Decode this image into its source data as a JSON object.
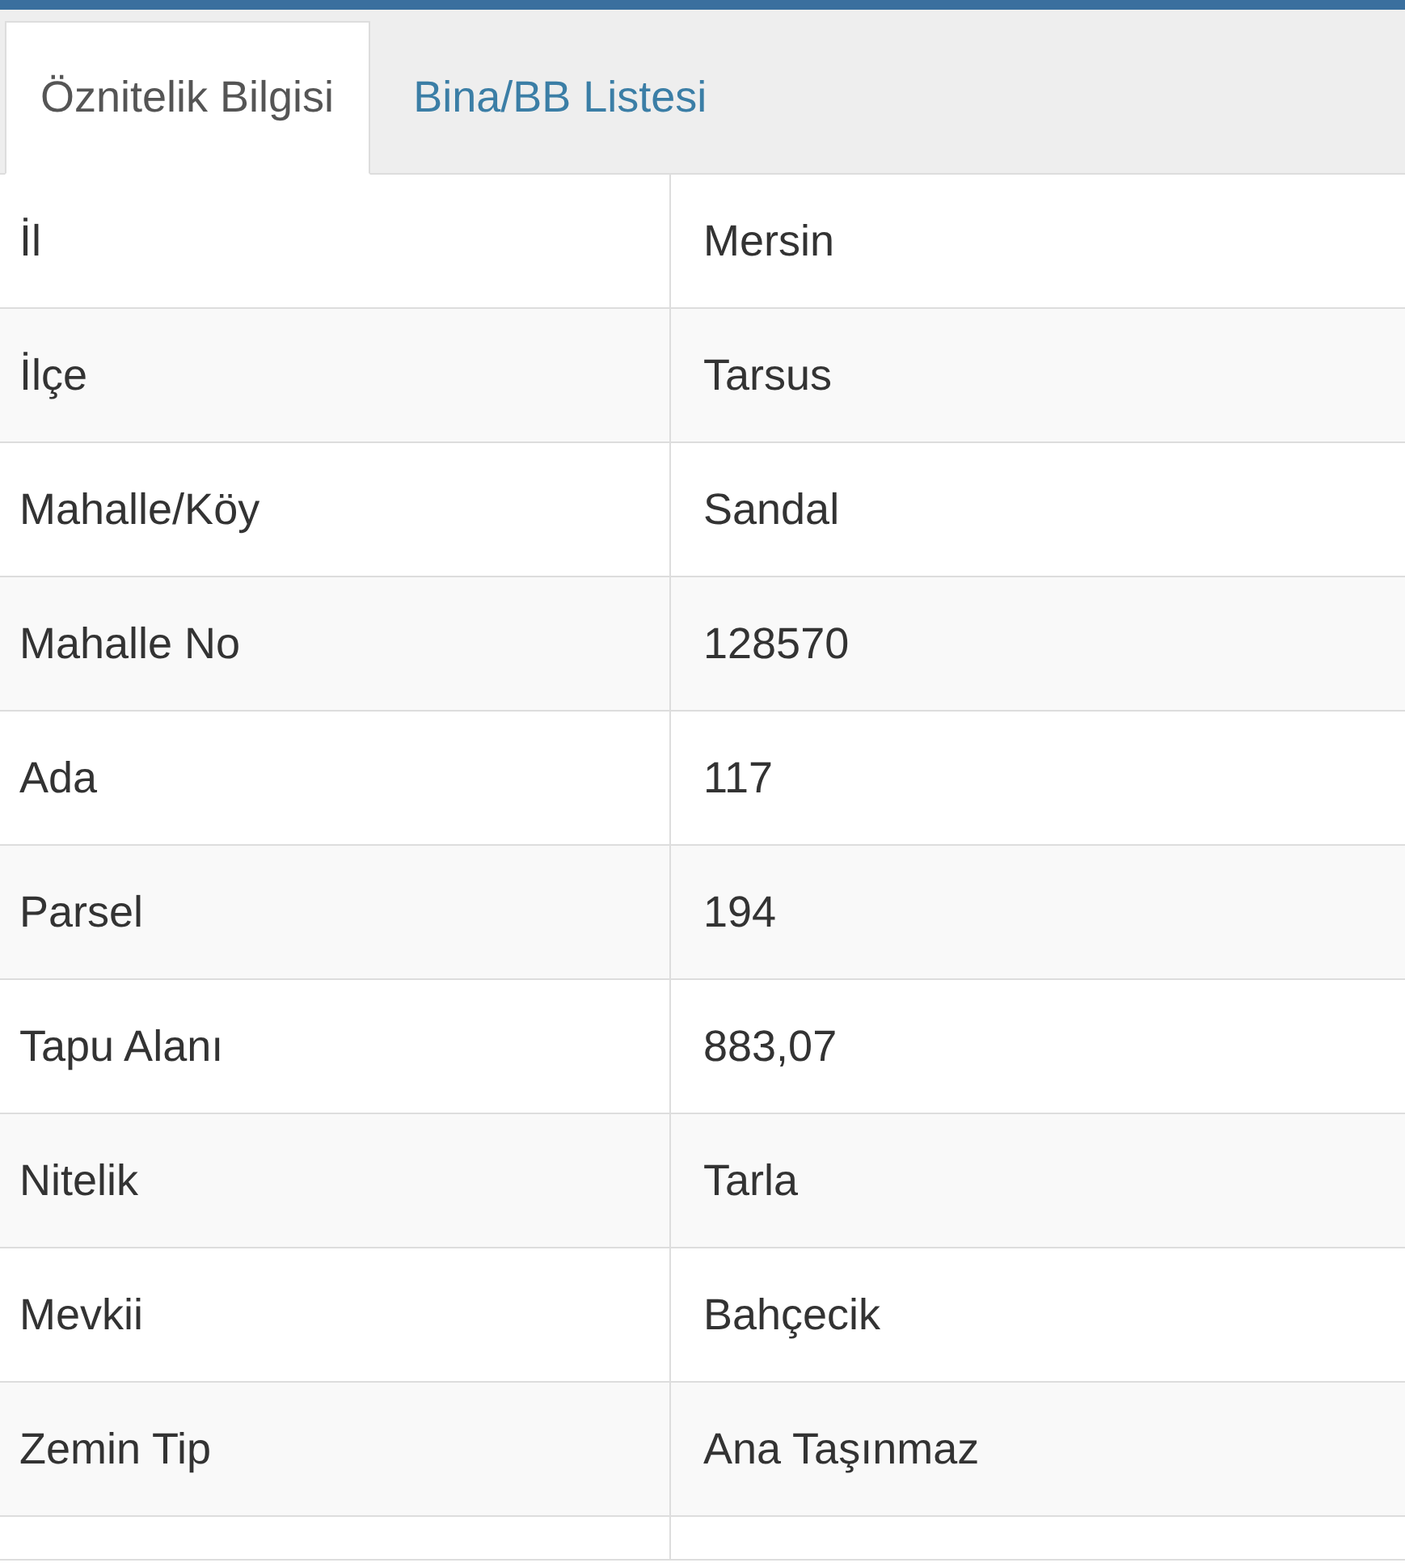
{
  "tabs": [
    {
      "label": "Öznitelik Bilgisi",
      "selected": true
    },
    {
      "label": "Bina/BB Listesi",
      "selected": false
    }
  ],
  "rows": [
    {
      "label": "İl",
      "value": "Mersin"
    },
    {
      "label": "İlçe",
      "value": "Tarsus"
    },
    {
      "label": "Mahalle/Köy",
      "value": "Sandal"
    },
    {
      "label": "Mahalle No",
      "value": "128570"
    },
    {
      "label": "Ada",
      "value": "117"
    },
    {
      "label": "Parsel",
      "value": "194"
    },
    {
      "label": "Tapu Alanı",
      "value": "883,07"
    },
    {
      "label": "Nitelik",
      "value": "Tarla"
    },
    {
      "label": "Mevkii",
      "value": "Bahçecik"
    },
    {
      "label": "Zemin Tip",
      "value": "Ana Taşınmaz"
    }
  ]
}
